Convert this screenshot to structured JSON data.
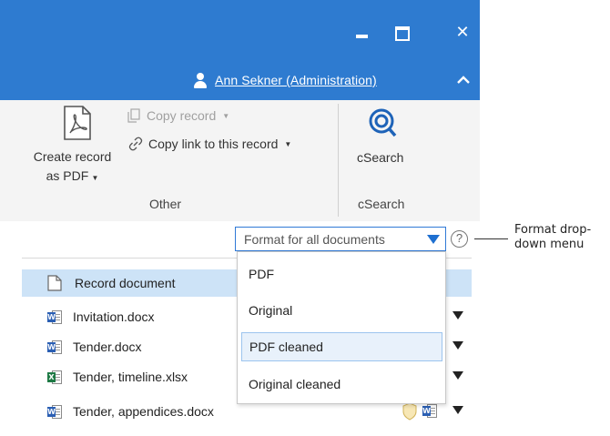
{
  "window": {
    "minimize_icon": "minimize-icon",
    "maximize_icon": "maximize-icon",
    "close_glyph": "✕"
  },
  "header": {
    "user_name": "Ann Sekner (Administration)",
    "user_icon": "user-icon",
    "collapse_icon": "chevron-up-icon"
  },
  "ribbon": {
    "create_pdf_line1": "Create record",
    "create_pdf_line2": "as PDF",
    "copy_record": "Copy record",
    "copy_link": "Copy link to this record",
    "group_other": "Other",
    "csearch": "cSearch",
    "group_csearch": "cSearch"
  },
  "format": {
    "label": "Format for all documents",
    "help": "?",
    "options": [
      "PDF",
      "Original",
      "PDF cleaned",
      "Original cleaned"
    ],
    "highlighted": "PDF cleaned"
  },
  "documents": [
    {
      "name": "Record document",
      "type": "record"
    },
    {
      "name": "Invitation.docx",
      "type": "word"
    },
    {
      "name": "Tender.docx",
      "type": "word"
    },
    {
      "name": "Tender, timeline.xlsx",
      "type": "excel"
    },
    {
      "name": "Tender, appendices.docx",
      "type": "word"
    }
  ],
  "callout": {
    "text": "Format drop-down menu"
  },
  "colors": {
    "titlebar": "#2e7bd0",
    "accent": "#3079d6",
    "selected_row": "#cde3f7"
  }
}
